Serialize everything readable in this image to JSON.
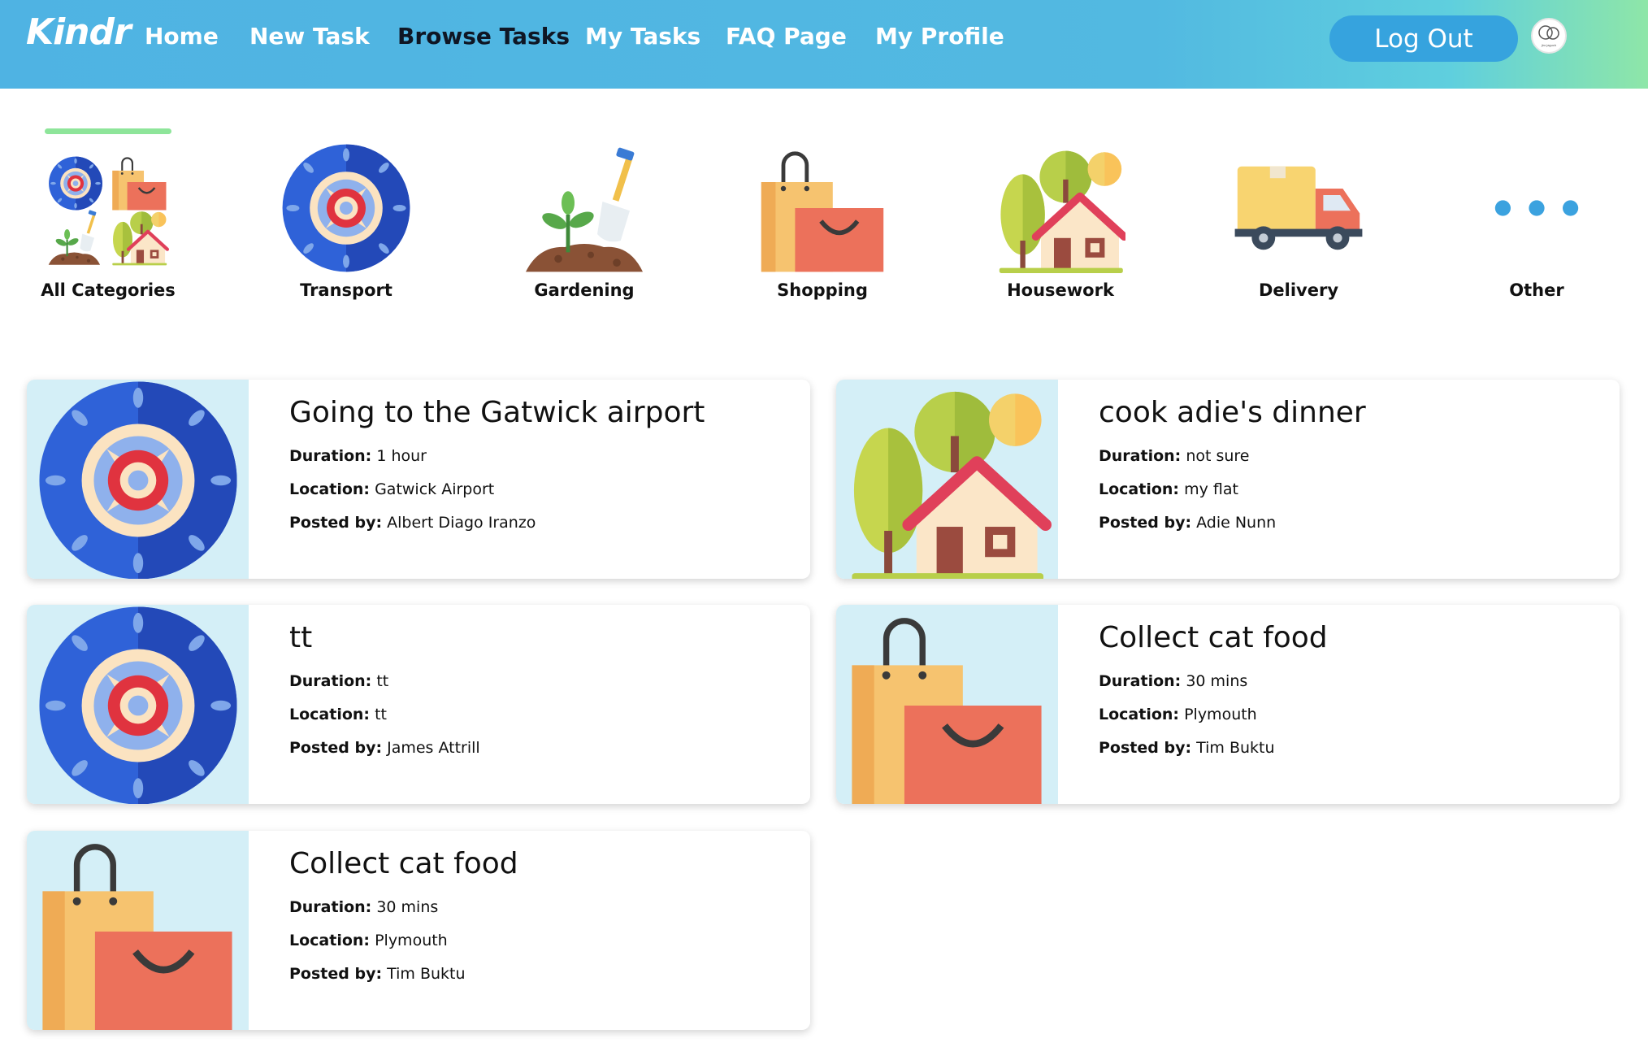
{
  "nav": {
    "logo": "Kindr",
    "links": [
      "Home",
      "New Task",
      "Browse Tasks",
      "My Tasks",
      "FAQ Page",
      "My Profile"
    ],
    "active": "Browse Tasks",
    "logout": "Log Out",
    "avatar_text": "jiro jaguch"
  },
  "categories": [
    {
      "label": "All Categories",
      "icon": "all-categories-icon"
    },
    {
      "label": "Transport",
      "icon": "tire-icon"
    },
    {
      "label": "Gardening",
      "icon": "plant-shovel-icon"
    },
    {
      "label": "Shopping",
      "icon": "shopping-bags-icon"
    },
    {
      "label": "Housework",
      "icon": "house-icon"
    },
    {
      "label": "Delivery",
      "icon": "truck-icon"
    },
    {
      "label": "Other",
      "icon": "more-dots-icon"
    }
  ],
  "field_labels": {
    "duration": "Duration:",
    "location": "Location:",
    "posted_by": "Posted by:"
  },
  "tasks": [
    {
      "title": "Going to the Gatwick airport",
      "duration": "1 hour",
      "location": "Gatwick Airport",
      "posted_by": "Albert Diago Iranzo",
      "category": "Transport"
    },
    {
      "title": "cook adie's dinner",
      "duration": "not sure",
      "location": "my flat",
      "posted_by": "Adie Nunn",
      "category": "Housework"
    },
    {
      "title": "tt",
      "duration": "tt",
      "location": "tt",
      "posted_by": "James Attrill",
      "category": "Transport"
    },
    {
      "title": "Collect cat food",
      "duration": "30 mins",
      "location": "Plymouth",
      "posted_by": "Tim Buktu",
      "category": "Shopping"
    },
    {
      "title": "Collect cat food",
      "duration": "30 mins",
      "location": "Plymouth",
      "posted_by": "Tim Buktu",
      "category": "Shopping"
    }
  ],
  "colors": {
    "accent": "#36a3de",
    "active_nav": "#0f1624",
    "category_active": "#8ee59a",
    "card_image_bg": "#d4eff7"
  }
}
